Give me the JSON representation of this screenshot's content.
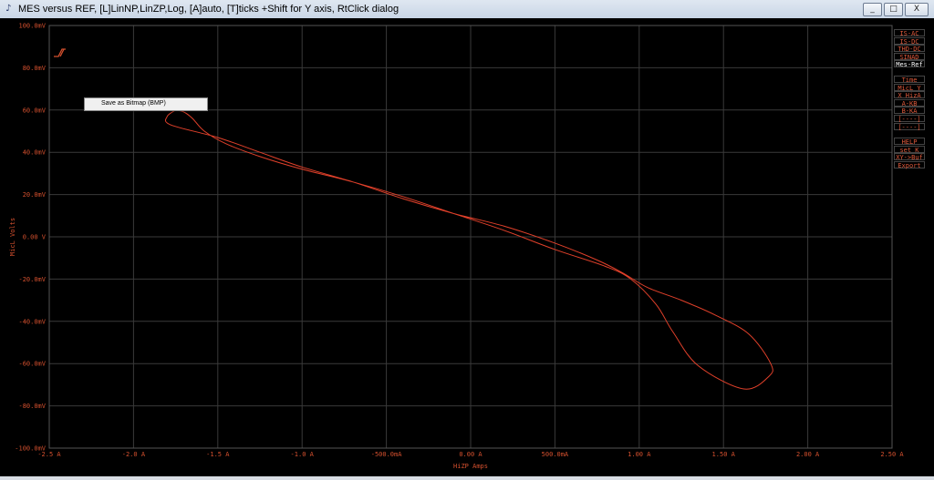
{
  "window": {
    "title": "MES versus REF, [L]LinNP,LinZP,Log, [A]auto, [T]ticks  +Shift for Y axis, RtClick dialog",
    "buttons": [
      "_",
      "□",
      "X"
    ]
  },
  "context_menu": {
    "item": "Save as Bitmap (BMP)"
  },
  "side_panel": {
    "group1": [
      {
        "label": "IS-AC",
        "color": "#e05a3c"
      },
      {
        "label": "IS-DC",
        "color": "#e05a3c"
      },
      {
        "label": "THD-DC",
        "color": "#e05a3c"
      },
      {
        "label": "SINAD",
        "color": "#e05a3c"
      },
      {
        "label": "Mes-Ref",
        "color": "#ffffff"
      }
    ],
    "group2": [
      {
        "label": "Time",
        "color": "#e05a3c"
      },
      {
        "label": "MicL Y",
        "color": "#e05a3c"
      },
      {
        "label": "X HizA",
        "color": "#e05a3c"
      },
      {
        "label": "A-KB",
        "color": "#e05a3c"
      },
      {
        "label": "B-KA",
        "color": "#e05a3c"
      },
      {
        "label": "[----]",
        "color": "#e05a3c"
      },
      {
        "label": "[----]",
        "color": "#e05a3c"
      }
    ],
    "group3": [
      {
        "label": "HELP",
        "color": "#e05a3c"
      },
      {
        "label": "set K",
        "color": "#e05a3c"
      },
      {
        "label": "XY->Buf",
        "color": "#e05a3c"
      },
      {
        "label": "Export",
        "color": "#e05a3c"
      }
    ]
  },
  "chart_data": {
    "type": "line",
    "xlabel": "HiZP Amps",
    "ylabel": "MicL Volts",
    "xlim": [
      -2.5,
      2.5
    ],
    "ylim": [
      -100,
      100
    ],
    "xticks": [
      "-2.5 A",
      "-2.0 A",
      "-1.5 A",
      "-1.0 A",
      "-500.0mA",
      "0.00 A",
      "500.0mA",
      "1.00 A",
      "1.50 A",
      "2.00 A",
      "2.50 A"
    ],
    "xtick_values": [
      -2.5,
      -2.0,
      -1.5,
      -1.0,
      -0.5,
      0,
      0.5,
      1.0,
      1.5,
      2.0,
      2.5
    ],
    "yticks": [
      "100.0mV",
      "80.0mV",
      "60.0mV",
      "40.0mV",
      "20.0mV",
      "0.00 V",
      "-20.0mV",
      "-40.0mV",
      "-60.0mV",
      "-80.0mV",
      "-100.0mV"
    ],
    "ytick_values": [
      100,
      80,
      60,
      40,
      20,
      0,
      -20,
      -40,
      -60,
      -80,
      -100
    ],
    "grid": true,
    "series": [
      {
        "color": "#e0402a",
        "x": [
          -1.75,
          -1.8,
          -1.78,
          -1.5,
          -1.25,
          -1.0,
          -0.7,
          -0.4,
          -0.1,
          0.2,
          0.5,
          0.75,
          0.9,
          1.05,
          1.25,
          1.45,
          1.65,
          1.78,
          1.77,
          1.62,
          1.35,
          1.2,
          1.1,
          0.95,
          0.8,
          0.5,
          0.2,
          -0.1,
          -0.4,
          -0.7,
          -1.0,
          -1.25,
          -1.45,
          -1.58,
          -1.65,
          -1.7,
          -1.75
        ],
        "y": [
          60,
          57,
          53,
          47,
          40,
          33,
          26,
          18,
          11,
          5,
          -3,
          -11,
          -17,
          -24,
          -30,
          -37,
          -46,
          -60,
          -66,
          -72,
          -61,
          -45,
          -32,
          -20,
          -14,
          -6,
          3,
          11,
          19,
          26,
          32,
          38,
          44,
          50,
          56,
          59,
          60
        ]
      }
    ]
  },
  "colors": {
    "background": "#000000",
    "grid": "#3a3a3a",
    "axis_text": "#d4502e",
    "trace": "#e0402a"
  }
}
